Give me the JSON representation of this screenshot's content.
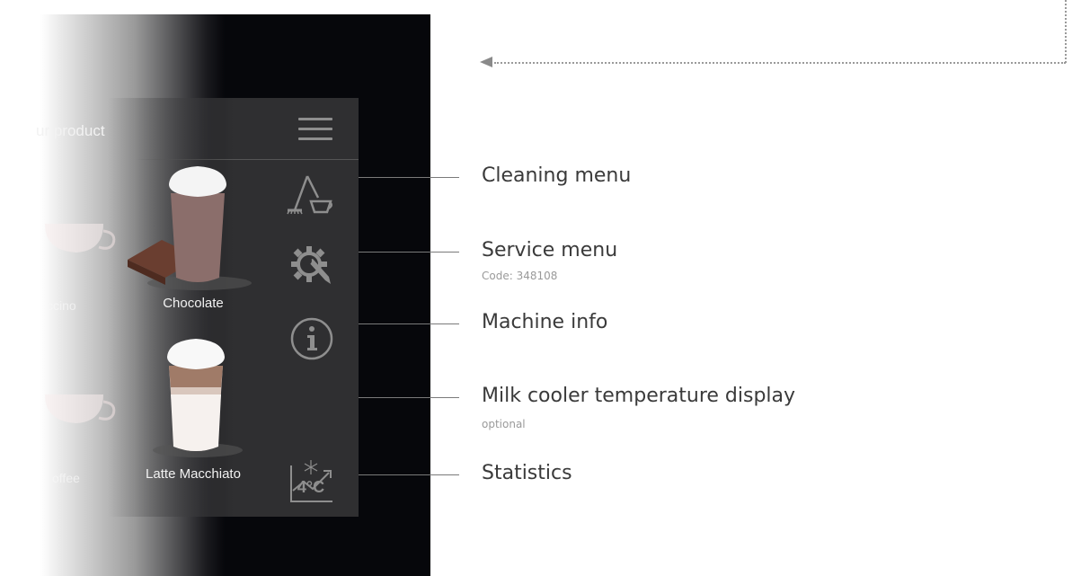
{
  "screen": {
    "title": "ur product",
    "products": [
      {
        "label": "ccino"
      },
      {
        "label": "Chocolate"
      },
      {
        "label": "offee"
      },
      {
        "label": "Latte Macchiato"
      }
    ],
    "menu_icons": [
      {
        "icon": "broom-cleaning-icon"
      },
      {
        "icon": "gear-wrench-icon"
      },
      {
        "icon": "info-icon"
      },
      {
        "icon": "snowflake-icon"
      },
      {
        "icon": "chart-line-icon"
      }
    ],
    "temperature": "4°C"
  },
  "callouts": [
    {
      "label": "Cleaning menu",
      "sub": ""
    },
    {
      "label": "Service menu",
      "sub": "Code: 348108"
    },
    {
      "label": "Machine info",
      "sub": ""
    },
    {
      "label": "Milk cooler temperature display",
      "sub": "optional"
    },
    {
      "label": "Statistics",
      "sub": ""
    }
  ],
  "colors": {
    "panel": "#2f2f31",
    "icon": "#8e8e8e",
    "device_bezel": "#06070b",
    "callout_line": "#7a7a7a",
    "callout_text": "#3a3a3a"
  }
}
